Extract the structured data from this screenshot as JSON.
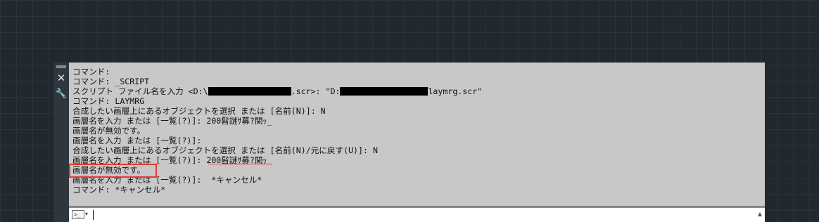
{
  "side": {
    "close_glyph": "✕",
    "settings_glyph": "🔧"
  },
  "history": {
    "lines": [
      "コマンド:",
      "コマンド: _SCRIPT",
      "スクリプト ファイル名を入力 <D:\\",
      "コマンド: LAYMRG",
      "合成したい画層上にあるオブジェクトを選択 または [名前(N)]: N",
      "画層名を入力 または [一覧(?)]: 200髫謎ｻ募?関ｯ_",
      "画層名が無効です。",
      "画層名を入力 または [一覧(?)]:",
      "合成したい画層上にあるオブジェクトを選択 または [名前(N)/元に戻す(U)]: N",
      "画層名を入力 または [一覧(?)]: 200髫謎ｻ募?関ｯ",
      "画層名が無効です。",
      "画層名を入力 または [一覧(?)]:  *キャンセル*",
      "コマンド: *キャンセル*"
    ],
    "script_line_mid": ".scr>: \"D:",
    "script_line_end": "laymrg.scr\""
  },
  "input": {
    "prompt_icon": ">_",
    "prompt_caret": "▾",
    "value": "",
    "scroll_glyph": "▲"
  }
}
